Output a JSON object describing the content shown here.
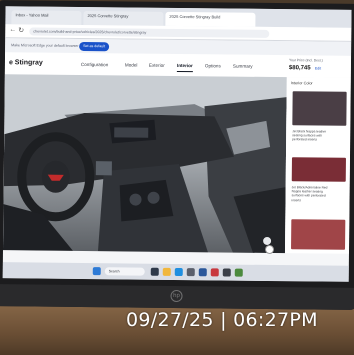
{
  "browser": {
    "tabs": [
      {
        "label": "Inbox - Yahoo Mail",
        "active": false
      },
      {
        "label": "2025 Corvette Stingray",
        "active": false
      },
      {
        "label": "2025 Corvette Stingray Build",
        "active": true
      }
    ],
    "url": "chevrolet.com/build-and-price/vehicles/2025/chevrolet/corvette/stingray",
    "infobar_text": "Make Microsoft Edge your default browser",
    "default_button": "Set as default"
  },
  "configurator": {
    "model": "e Stingray",
    "tabs": [
      "Configuration",
      "Model",
      "Exterior",
      "Interior",
      "Options",
      "Summary"
    ],
    "active_tab": "Interior",
    "price_label": "Your Price (Incl. Dest.)",
    "price": "$80,745",
    "price_action": "Edit"
  },
  "panel": {
    "title": "Interior Color",
    "swatches": [
      {
        "color": "#4a3e45",
        "text": ""
      },
      {
        "color": "#7a2d36",
        "text": "Jet Black Nappa leather seating surfaces with perforated inserts"
      },
      {
        "color": "#6b2e34",
        "text": "Jet Black/Adrenaline Red Nappa leather seating surfaces with perforated inserts"
      },
      {
        "color": "#a04548",
        "text": ""
      }
    ]
  },
  "taskbar": {
    "search_placeholder": "Search"
  },
  "photo": {
    "date": "09/27/25",
    "separator": "|",
    "time": "06:27PM",
    "laptop_brand": "hp"
  }
}
